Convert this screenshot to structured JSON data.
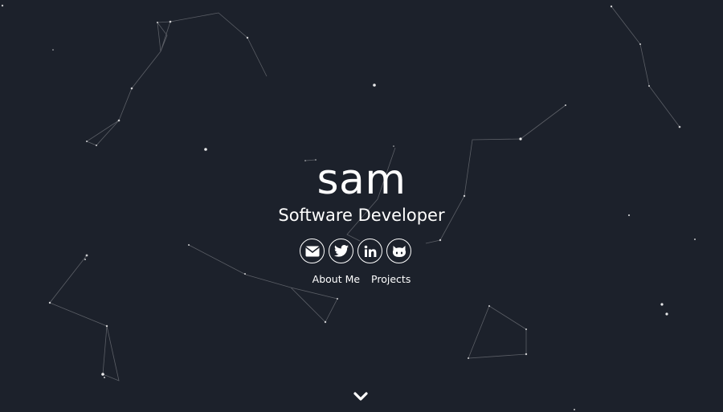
{
  "hero": {
    "name": "sam",
    "role": "Software Developer"
  },
  "social": [
    {
      "icon": "envelope-icon",
      "label": "email"
    },
    {
      "icon": "twitter-icon",
      "label": "twitter"
    },
    {
      "icon": "linkedin-icon",
      "label": "linkedin"
    },
    {
      "icon": "github-icon",
      "label": "github"
    }
  ],
  "nav": {
    "about": "About Me",
    "projects": "Projects"
  },
  "colors": {
    "background": "#1c212b",
    "foreground": "#ffffff"
  }
}
